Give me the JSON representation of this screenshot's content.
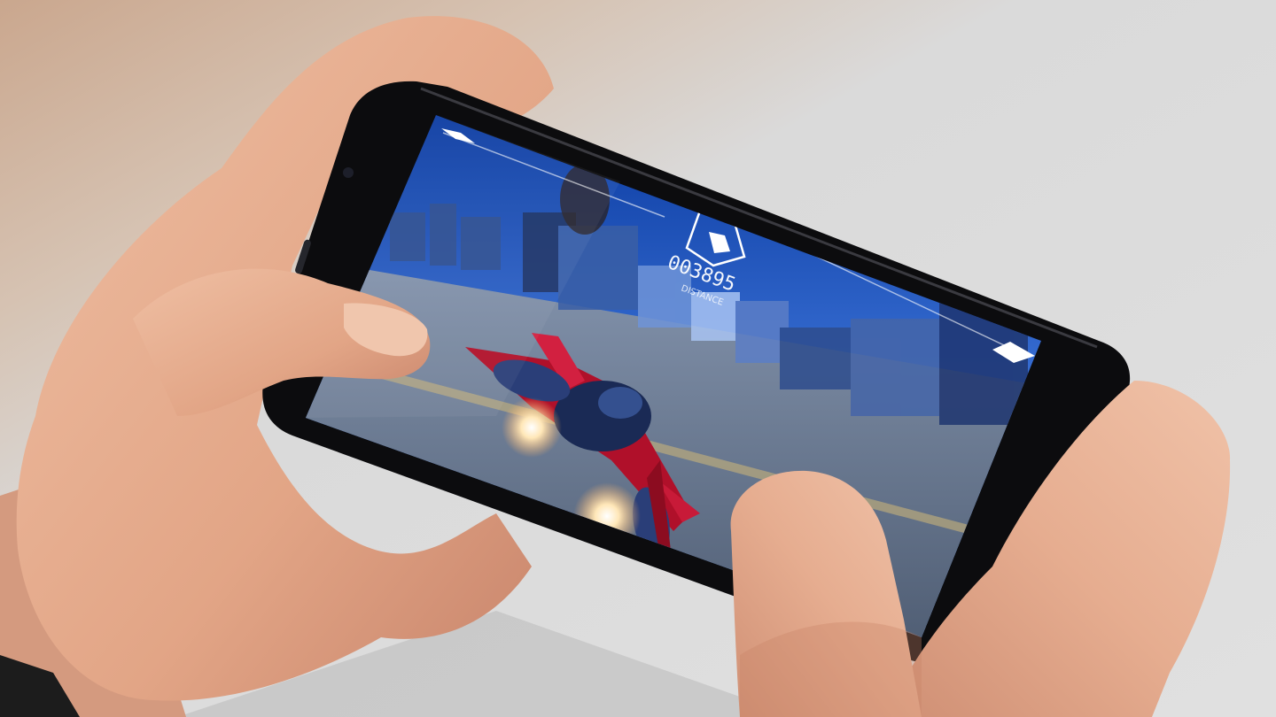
{
  "photo": {
    "subject": "hands-holding-smartphone-playing-game",
    "colors": {
      "background": "#d9d9d9",
      "table_warm": "#c9a98f",
      "skin": "#e3ab8e",
      "skin_shadow": "#c98468",
      "phone_body": "#0d0d0f",
      "sky_top": "#0b3fa8",
      "sky_bottom": "#5b8ee8",
      "ground": "#6f7e93",
      "ship_red": "#b0102a",
      "ship_dark": "#1a2a55",
      "engine_glow": "#ffe9c0",
      "hud_white": "#ffffff"
    }
  },
  "game_hud": {
    "score": "003895",
    "distance_label": "DISTANCE",
    "emblem_icon": "ship-emblem-icon",
    "left_marker_icon": "arrow-marker-icon",
    "right_marker_icon": "arrow-marker-icon"
  }
}
